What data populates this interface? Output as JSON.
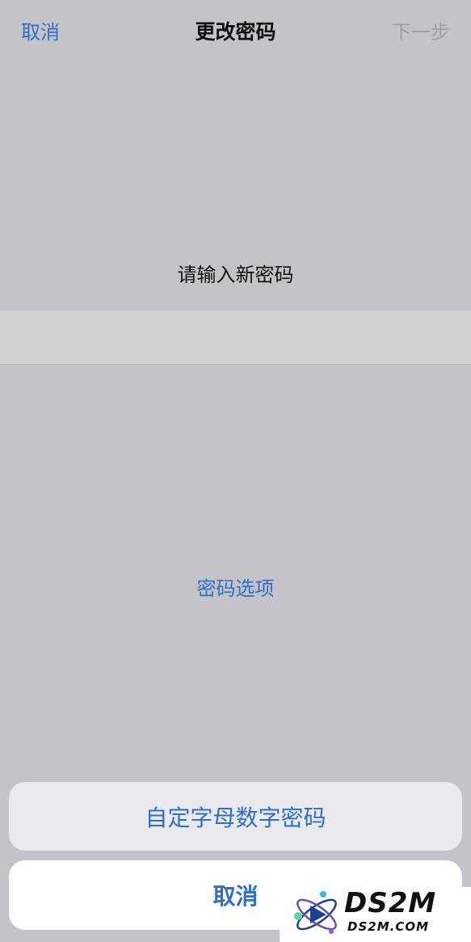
{
  "nav": {
    "cancel_label": "取消",
    "title": "更改密码",
    "next_label": "下一步"
  },
  "main": {
    "prompt": "请输入新密码",
    "password_value": "",
    "options_label": "密码选项"
  },
  "action_sheet": {
    "option_label": "自定字母数字密码",
    "cancel_label": "取消"
  },
  "watermark": {
    "title": "DS2M",
    "url": "DS2M.COM"
  },
  "colors": {
    "accent": "#2f6fc8",
    "background": "#c4c3c8",
    "disabled": "#a0a0a5"
  }
}
